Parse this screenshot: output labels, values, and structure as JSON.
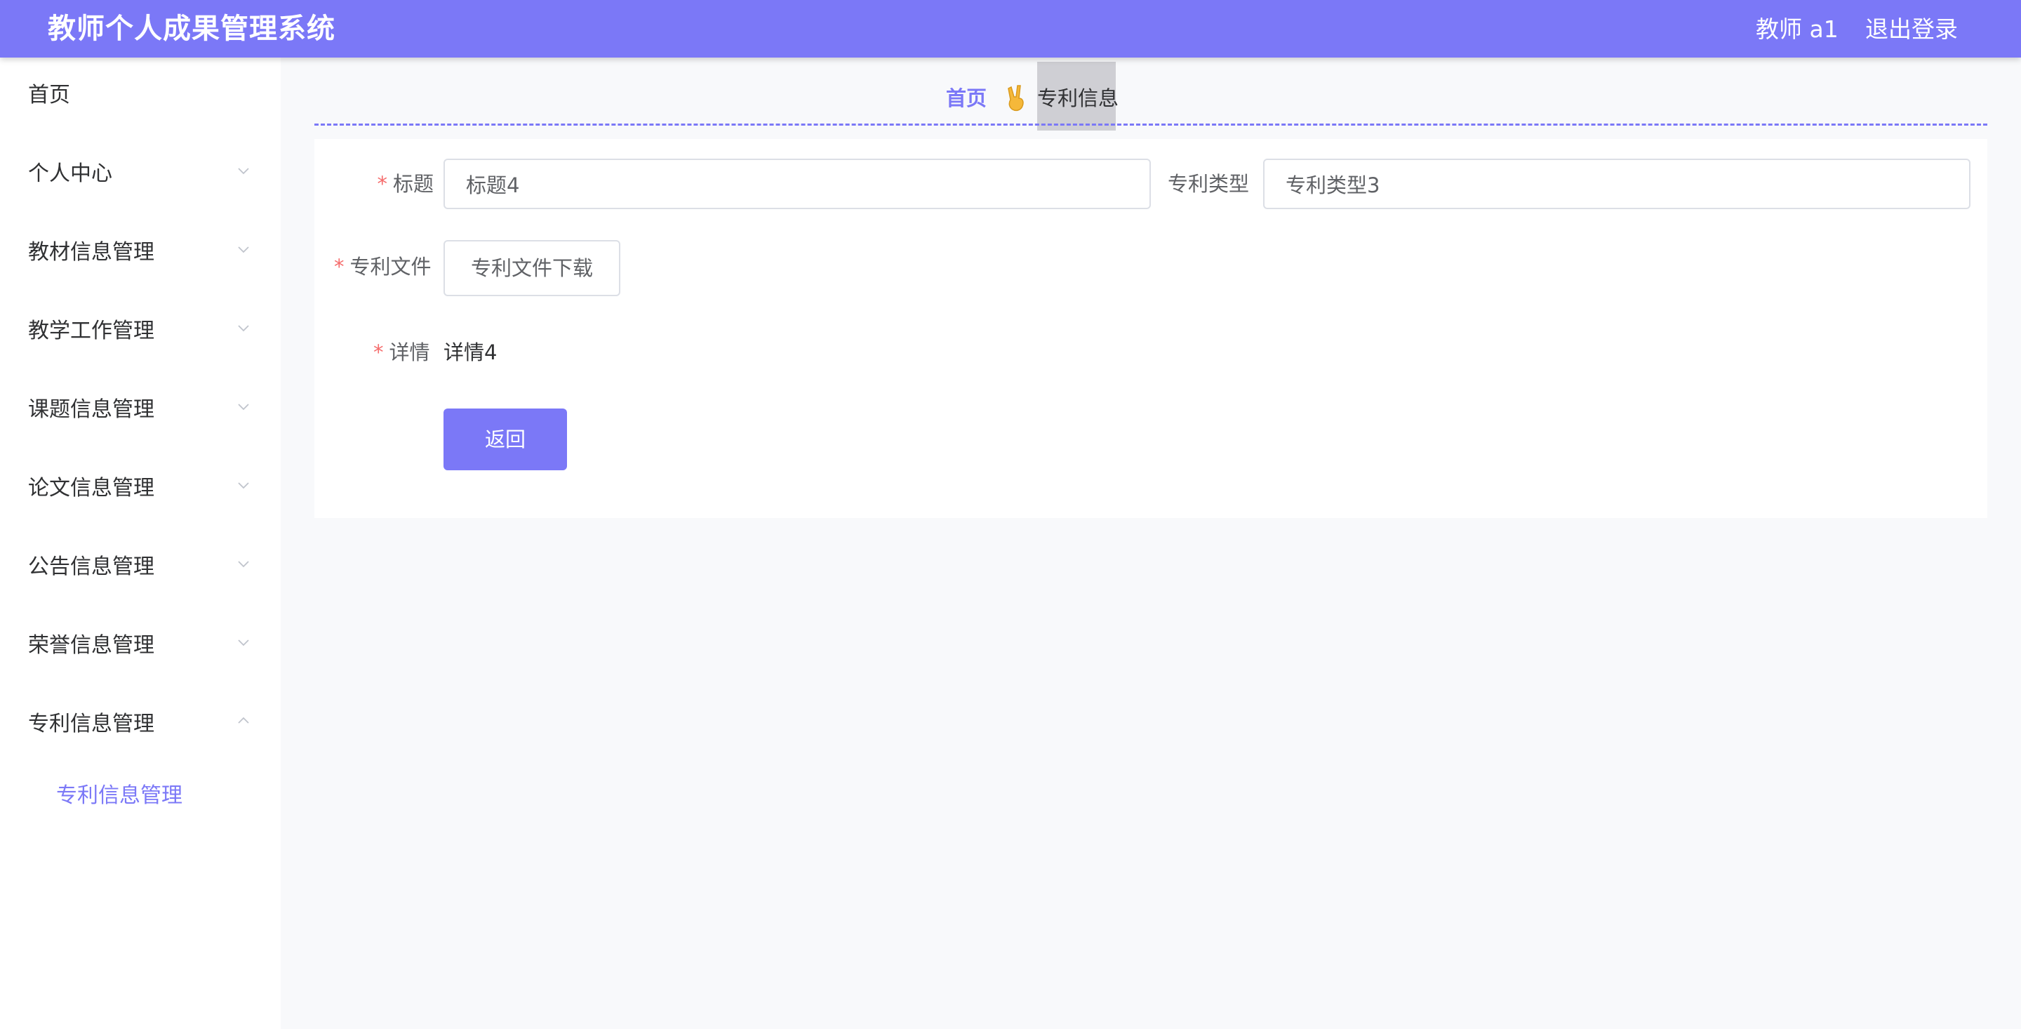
{
  "header": {
    "title": "教师个人成果管理系统",
    "user": "教师 a1",
    "logout": "退出登录"
  },
  "sidebar": {
    "items": [
      {
        "label": "首页",
        "icon": "none"
      },
      {
        "label": "个人中心",
        "icon": "chevron-down-icon"
      },
      {
        "label": "教材信息管理",
        "icon": "chevron-down-icon"
      },
      {
        "label": "教学工作管理",
        "icon": "chevron-down-icon"
      },
      {
        "label": "课题信息管理",
        "icon": "chevron-down-icon"
      },
      {
        "label": "论文信息管理",
        "icon": "chevron-down-icon"
      },
      {
        "label": "公告信息管理",
        "icon": "chevron-down-icon"
      },
      {
        "label": "荣誉信息管理",
        "icon": "chevron-down-icon"
      },
      {
        "label": "专利信息管理",
        "icon": "chevron-up-icon"
      }
    ],
    "submenu": {
      "label": "专利信息管理"
    }
  },
  "breadcrumb": {
    "home": "首页",
    "separator_icon": "victory-hand-icon",
    "current": "专利信息"
  },
  "form": {
    "title_label": "标题",
    "title_value": "标题4",
    "type_label": "专利类型",
    "type_value": "专利类型3",
    "file_label": "专利文件",
    "file_button": "专利文件下载",
    "detail_label": "详情",
    "detail_value": "详情4",
    "back_button": "返回"
  },
  "colors": {
    "accent": "#7b78f7",
    "required": "#f56c6c",
    "background": "#f8f9fb"
  }
}
